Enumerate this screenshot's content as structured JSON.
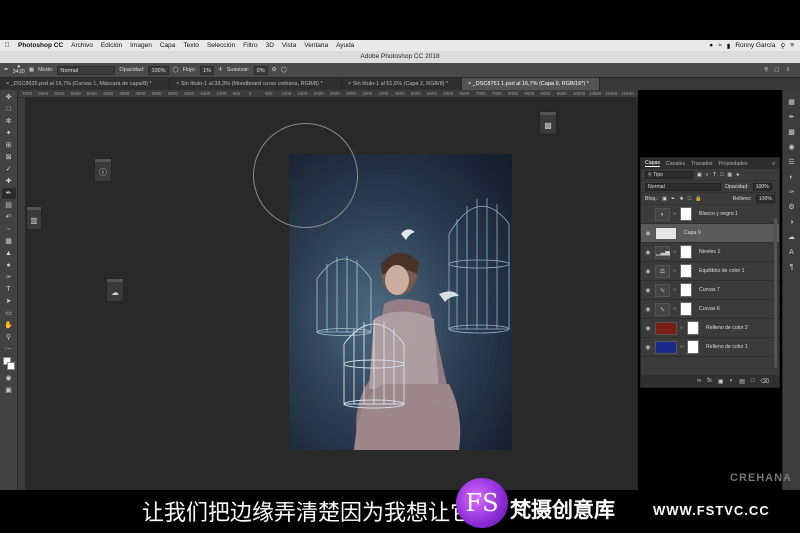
{
  "menubar": {
    "app": "Photoshop CC",
    "items": [
      "Archivo",
      "Edición",
      "Imagen",
      "Capa",
      "Texto",
      "Selección",
      "Filtro",
      "3D",
      "Vista",
      "Ventana",
      "Ayuda"
    ],
    "user": "Ronny García"
  },
  "window": {
    "title": "Adobe Photoshop CC 2018"
  },
  "options": {
    "brush_size": "3420",
    "mode_label": "Modo:",
    "mode_value": "Normal",
    "opacity_label": "Opacidad:",
    "opacity_value": "100%",
    "flow_label": "Flujo:",
    "flow_value": "1%",
    "smooth_label": "Suavizar:",
    "smooth_value": "0%"
  },
  "tabs": [
    {
      "label": "_DSC8635.psd al 16,7% (Curvas 1, Máscara de capa/8) *"
    },
    {
      "label": "Sin título-1 al 33,3% (Moodboard curso crehana, RGB/8) *"
    },
    {
      "label": "Sin título-1 al 51,6% (Capa 2, RGB/8) *"
    },
    {
      "label": "_DSC8751 1.psd al 16,7% (Capa 9, RGB/16*) *"
    }
  ],
  "ruler": [
    "7000",
    "6500",
    "6000",
    "5500",
    "5000",
    "4500",
    "4000",
    "3500",
    "3000",
    "2500",
    "2000",
    "1500",
    "1000",
    "500",
    "0",
    "500",
    "1000",
    "1500",
    "2000",
    "2500",
    "3000",
    "3500",
    "4000",
    "4500",
    "5000",
    "5500",
    "6000",
    "6500",
    "7000",
    "7500",
    "8000",
    "8500",
    "9000",
    "9500",
    "10000",
    "10500",
    "11000",
    "11500"
  ],
  "layers_panel": {
    "tabs": [
      "Capas",
      "Canales",
      "Trazados",
      "Propiedades"
    ],
    "filter": "Tipo",
    "blend_mode": "Normal",
    "opacity_label": "Opacidad:",
    "opacity_value": "100%",
    "lock_label": "Bloq.:",
    "fill_label": "Relleno:",
    "fill_value": "100%",
    "layers": [
      {
        "name": "Blanco y negro 1",
        "kind": "bw",
        "visible": false,
        "selected": false
      },
      {
        "name": "Capa 9",
        "kind": "pixel",
        "visible": true,
        "selected": true
      },
      {
        "name": "Niveles 1",
        "kind": "levels",
        "visible": true,
        "selected": false
      },
      {
        "name": "Equilibrio de color 1",
        "kind": "balance",
        "visible": true,
        "selected": false
      },
      {
        "name": "Curvas 7",
        "kind": "curves",
        "visible": true,
        "selected": false
      },
      {
        "name": "Curvas 6",
        "kind": "curves",
        "visible": true,
        "selected": false
      },
      {
        "name": "Relleno de color 2",
        "kind": "fill",
        "color": "#7a1f17",
        "visible": true,
        "selected": false
      },
      {
        "name": "Relleno de color 1",
        "kind": "fill",
        "color": "#1a2a8c",
        "visible": true,
        "selected": false
      }
    ]
  },
  "overlay": {
    "subtitle": "让我们把边缘弄清楚因为我想让它",
    "watermark_brand": "CREHANA",
    "logo_text": "FS",
    "watermark_cn": "梵摄创意库",
    "watermark_url": "WWW.FSTVC.CC"
  }
}
